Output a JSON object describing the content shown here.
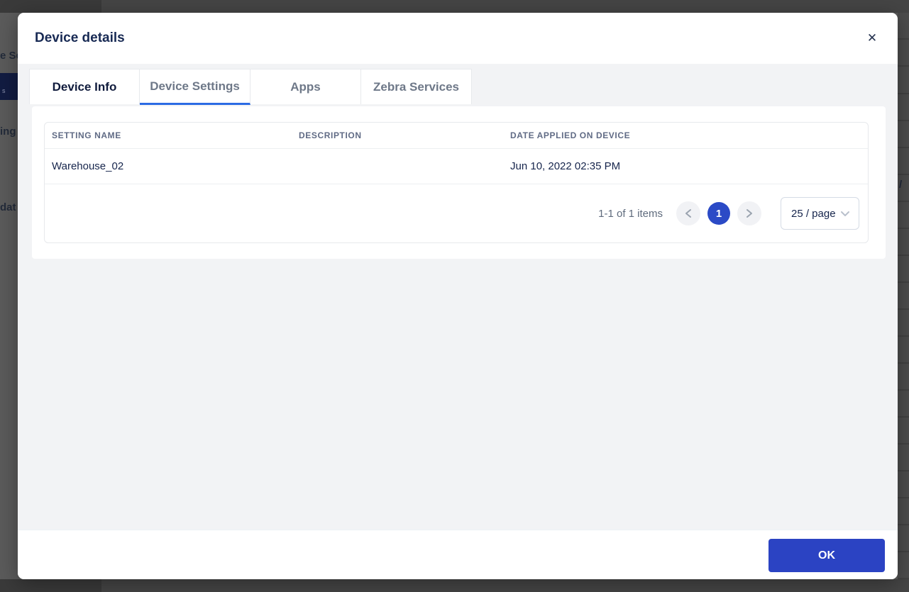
{
  "background": {
    "fragments": {
      "left_top": "e Se",
      "left_nav_item": "s",
      "left_mid": "ing",
      "left_bottom": "dat",
      "right": "/"
    }
  },
  "modal": {
    "title": "Device details",
    "close_icon": "✕",
    "tabs": [
      {
        "label": "Device Info"
      },
      {
        "label": "Device Settings"
      },
      {
        "label": "Apps"
      },
      {
        "label": "Zebra Services"
      }
    ],
    "active_tab": "Device Settings",
    "table": {
      "columns": [
        "SETTING NAME",
        "DESCRIPTION",
        "DATE APPLIED ON DEVICE"
      ],
      "rows": [
        {
          "setting_name": "Warehouse_02",
          "description": "",
          "date_applied": "Jun 10, 2022 02:35 PM"
        }
      ]
    },
    "pagination": {
      "summary": "1-1 of 1 items",
      "current_page": "1",
      "page_size": "25 / page"
    },
    "footer": {
      "ok_label": "OK"
    }
  },
  "colors": {
    "accent_blue": "#2b4ac6",
    "tab_underline_blue": "#2b6be4",
    "title_navy": "#182a54",
    "body_gray": "#f2f3f5",
    "overlay_gray": "#5b5b5b"
  }
}
